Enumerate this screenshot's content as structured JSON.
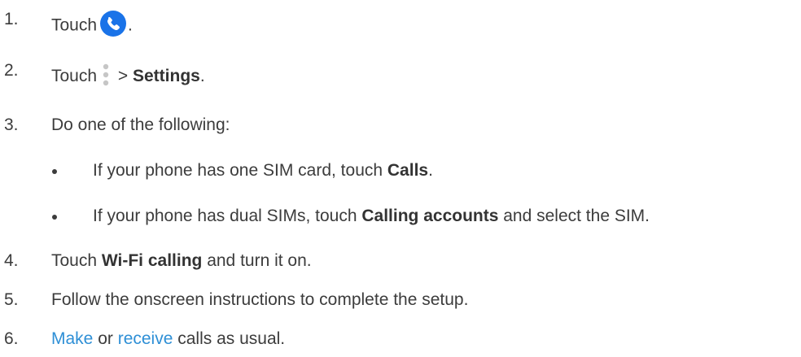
{
  "steps": [
    {
      "num": "1.",
      "prefix": "Touch",
      "suffix": ".",
      "icon": "phone-app-icon",
      "icon_color": "#1a73e8"
    },
    {
      "num": "2.",
      "prefix": "Touch",
      "sep": " > ",
      "bold": "Settings",
      "suffix": ".",
      "icon": "more-options-icon"
    },
    {
      "num": "3.",
      "text": "Do one of the following:"
    },
    {
      "num": "4.",
      "prefix": "Touch ",
      "bold": "Wi-Fi calling",
      "suffix": " and turn it on."
    },
    {
      "num": "5.",
      "text": "Follow the onscreen instructions to complete the setup."
    },
    {
      "num": "6.",
      "link1": "Make",
      "mid": " or ",
      "link2": "receive",
      "suffix": " calls as usual.",
      "link_color": "#2e8fd6"
    }
  ],
  "bullets": [
    {
      "prefix": "If your phone has one SIM card, touch ",
      "bold": "Calls",
      "suffix": "."
    },
    {
      "prefix": "If your phone has dual SIMs, touch ",
      "bold": "Calling accounts",
      "suffix": " and select the SIM."
    }
  ]
}
